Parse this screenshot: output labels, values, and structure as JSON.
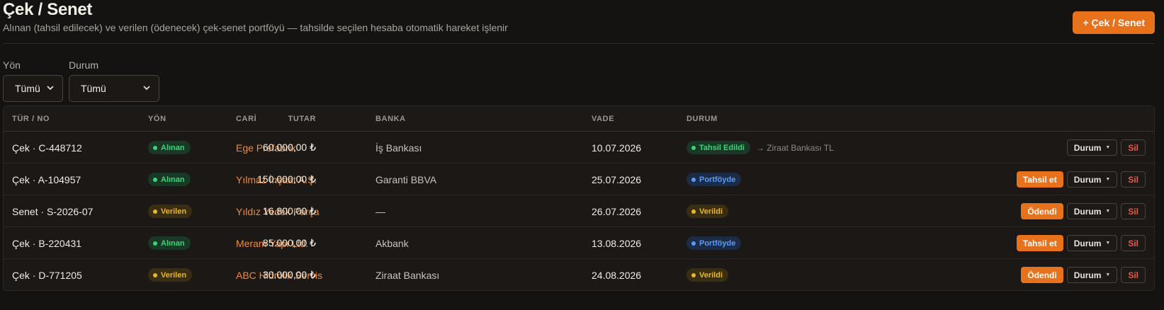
{
  "header": {
    "title": "Çek / Senet",
    "subtitle": "Alınan (tahsil edilecek) ve verilen (ödenecek) çek-senet portföyü — tahsilde seçilen hesaba otomatik hareket işlenir",
    "new_button_label": "+ Çek / Senet"
  },
  "filters": {
    "direction": {
      "label": "Yön",
      "value": "Tümü"
    },
    "status": {
      "label": "Durum",
      "value": "Tümü"
    }
  },
  "table": {
    "columns": [
      "TÜR / NO",
      "YÖN",
      "CARİ",
      "BANKA",
      "TUTAR",
      "VADE",
      "DURUM"
    ],
    "rows": [
      {
        "no": "Çek · C-448712",
        "direction": "Alınan",
        "direction_color": "green",
        "cari": "Ege Prefabrik",
        "bank": "İş Bankası",
        "amount": "60.000,00 ₺",
        "due": "10.07.2026",
        "status": "Tahsil Edildi",
        "status_color": "green",
        "status_note": "→ Ziraat Bankası TL",
        "primary_action": "",
        "menu_label": "Durum",
        "delete_label": "Sil"
      },
      {
        "no": "Çek · A-104957",
        "direction": "Alınan",
        "direction_color": "green",
        "cari": "Yılmaz İnşaat A.Ş.",
        "bank": "Garanti BBVA",
        "amount": "150.000,00 ₺",
        "due": "25.07.2026",
        "status": "Portföyde",
        "status_color": "blue",
        "status_note": "",
        "primary_action": "Tahsil et",
        "menu_label": "Durum",
        "delete_label": "Sil"
      },
      {
        "no": "Senet · S-2026-07",
        "direction": "Verilen",
        "direction_color": "yellow",
        "cari": "Yıldız Yedek Parça",
        "bank": "—",
        "amount": "16.800,00 ₺",
        "due": "26.07.2026",
        "status": "Verildi",
        "status_color": "yellow",
        "status_note": "",
        "primary_action": "Ödendi",
        "menu_label": "Durum",
        "delete_label": "Sil"
      },
      {
        "no": "Çek · B-220431",
        "direction": "Alınan",
        "direction_color": "green",
        "cari": "Meram Yapı Ltd.",
        "bank": "Akbank",
        "amount": "85.000,00 ₺",
        "due": "13.08.2026",
        "status": "Portföyde",
        "status_color": "blue",
        "status_note": "",
        "primary_action": "Tahsil et",
        "menu_label": "Durum",
        "delete_label": "Sil"
      },
      {
        "no": "Çek · D-771205",
        "direction": "Verilen",
        "direction_color": "yellow",
        "cari": "ABC Hidrolik Servis",
        "bank": "Ziraat Bankası",
        "amount": "30.000,00 ₺",
        "due": "24.08.2026",
        "status": "Verildi",
        "status_color": "yellow",
        "status_note": "",
        "primary_action": "Ödendi",
        "menu_label": "Durum",
        "delete_label": "Sil"
      }
    ]
  },
  "colors": {
    "accent": "#e8711c",
    "background": "#151311",
    "green": "#3fd37a",
    "yellow": "#eab52f",
    "blue": "#5b9bf5",
    "danger": "#f0564f"
  },
  "icons": {
    "select_chevron": "chevron-down-icon",
    "menu_caret": "caret-down-icon",
    "status_dot": "dot-icon"
  }
}
